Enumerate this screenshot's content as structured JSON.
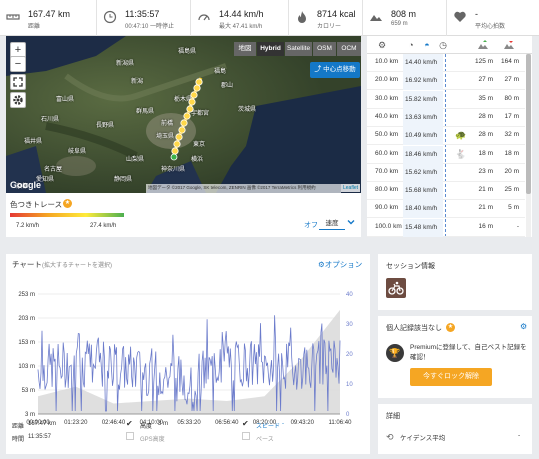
{
  "stats": {
    "distance": {
      "value": "167.47 km",
      "sub": "距離"
    },
    "time": {
      "value": "11:35:57",
      "sub": "00:47:10 一時停止"
    },
    "speed": {
      "value": "14.44 km/h",
      "sub": "最大 47.41 km/h"
    },
    "calories": {
      "value": "8714 kcal",
      "sub": "カロリー"
    },
    "elevation": {
      "value": "808 m",
      "sub": "659 m"
    },
    "heart": {
      "value": "-",
      "sub": "平均心拍数"
    }
  },
  "map": {
    "zoom_in": "+",
    "zoom_out": "−",
    "tabs": [
      "地図",
      "Hybrid",
      "Satellite",
      "OSM",
      "OCM"
    ],
    "active_tab": "Hybrid",
    "center_button": "中心点移動",
    "google": "Google",
    "attribution": "地図データ ©2017 Google, SK telecom, ZENRIN 画像 ©2017 TerraMetrics 利用規約",
    "leaflet": "Leaflet",
    "labels": [
      "福島県",
      "新潟県",
      "栃木県",
      "群馬県",
      "茨城県",
      "長野県",
      "埼玉県",
      "東京",
      "山梨県",
      "静岡県",
      "神奈川県",
      "横浜",
      "富山県",
      "石川県",
      "岐阜県",
      "愛知県",
      "福井県",
      "名古屋",
      "京都",
      "新潟",
      "前橋",
      "宇都宮",
      "福島",
      "郡山"
    ]
  },
  "splits": {
    "rows": [
      {
        "dist": "10.0 km",
        "speed": "14.40 km/h",
        "up": "125 m",
        "down": "164 m",
        "icon": ""
      },
      {
        "dist": "20.0 km",
        "speed": "16.92 km/h",
        "up": "27 m",
        "down": "27 m",
        "icon": ""
      },
      {
        "dist": "30.0 km",
        "speed": "15.82 km/h",
        "up": "35 m",
        "down": "80 m",
        "icon": ""
      },
      {
        "dist": "40.0 km",
        "speed": "13.63 km/h",
        "up": "28 m",
        "down": "17 m",
        "icon": ""
      },
      {
        "dist": "50.0 km",
        "speed": "10.49 km/h",
        "up": "28 m",
        "down": "32 m",
        "icon": "turtle"
      },
      {
        "dist": "60.0 km",
        "speed": "18.46 km/h",
        "up": "18 m",
        "down": "18 m",
        "icon": "rabbit"
      },
      {
        "dist": "70.0 km",
        "speed": "15.62 km/h",
        "up": "23 m",
        "down": "20 m",
        "icon": ""
      },
      {
        "dist": "80.0 km",
        "speed": "15.68 km/h",
        "up": "21 m",
        "down": "25 m",
        "icon": ""
      },
      {
        "dist": "90.0 km",
        "speed": "18.40 km/h",
        "up": "21 m",
        "down": "5 m",
        "icon": ""
      },
      {
        "dist": "100.0 km",
        "speed": "15.48 km/h",
        "up": "16 m",
        "down": "-",
        "icon": ""
      }
    ]
  },
  "trace": {
    "title": "色つきトレース",
    "min": "7.2 km/h",
    "max": "27.4 km/h",
    "off": "オフ",
    "selected": "速度"
  },
  "chart": {
    "title": "チャート",
    "hint": "(拡大するチャートを選択)",
    "options": "オプション",
    "left_ticks": [
      "253 m",
      "203 m",
      "153 m",
      "103 m",
      "53 m",
      "3 m"
    ],
    "right_ticks": [
      "40",
      "30",
      "20",
      "10",
      "0"
    ],
    "x_ticks": [
      "00:00:00",
      "01:23:20",
      "02:46:40",
      "04:10:00",
      "05:33:20",
      "06:56:40",
      "08:20:00",
      "09:43:20",
      "11:06:40"
    ],
    "dist_label": "距離",
    "dist_value": "167.47 km",
    "time_label": "時間",
    "time_value": "11:35:57",
    "elev_label": "高度",
    "elev_value": "3 m",
    "gps_elev": "GPS高度",
    "speed_label": "スピード",
    "speed_value": "-",
    "pace_label": "ペース"
  },
  "chart_data": {
    "type": "line",
    "x": [
      "00:00:00",
      "01:23:20",
      "02:46:40",
      "04:10:00",
      "05:33:20",
      "06:56:40",
      "08:20:00",
      "09:43:20",
      "11:06:40"
    ],
    "series": [
      {
        "name": "高度",
        "values": [
          40,
          60,
          25,
          30,
          35,
          30,
          40,
          120,
          220
        ]
      },
      {
        "name": "スピード",
        "values": [
          15,
          17,
          16,
          14,
          11,
          18,
          16,
          16,
          18
        ]
      }
    ],
    "ylim": [
      3,
      253
    ],
    "y2lim": [
      0,
      40
    ]
  },
  "session": {
    "title": "セッション情報"
  },
  "records": {
    "title": "個人記録該当なし",
    "text": "Premiumに登録して、自己ベスト記録を確認！",
    "button": "今すぐロック解除"
  },
  "details": {
    "title": "詳細",
    "cadence_label": "ケイデンス平均",
    "cadence_value": "-"
  },
  "colors": {
    "accent": "#1478c8",
    "orange": "#f5a623",
    "route": "#f5c518",
    "speed_line": "#6b7bcb",
    "elev_fill": "#d9d9d9"
  }
}
